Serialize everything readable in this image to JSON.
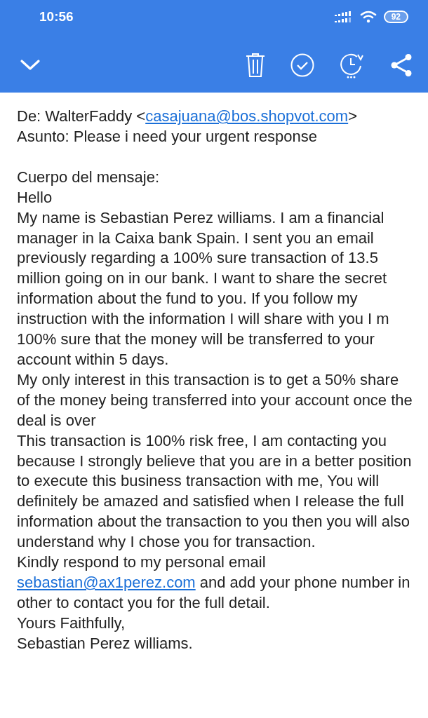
{
  "status_bar": {
    "time": "10:56",
    "battery": "92"
  },
  "email": {
    "from": {
      "prefix": "De: WalterFaddy <",
      "email": "casajuana@bos.shopvot.com",
      "suffix": ">"
    },
    "subject": "Asunto: Please i need your urgent response",
    "body_label": "Cuerpo del mensaje:",
    "paragraphs": [
      {
        "text": "Hello"
      },
      {
        "text": "My name is Sebastian Perez williams. I am a financial manager in la Caixa bank Spain. I sent you an email previously regarding a 100% sure transaction of 13.5 million going on in our bank. I want to share the secret information about the fund to you. If you follow my instruction with the information I will share with you I m 100% sure that the money will be transferred to your account within 5 days."
      },
      {
        "text": "My only interest in this transaction is to get a 50% share of the money being transferred into your account once the deal is over"
      },
      {
        "text": "This transaction is 100% risk free, I am contacting you because I strongly believe that you are in a better position to execute this business transaction with me, You will definitely be amazed and satisfied when I release the full information about the transaction to you then you will also understand why I chose you for transaction."
      },
      {
        "text": "Kindly respond to my personal email",
        "link": "sebastian@ax1perez.com",
        "after": "and add your phone number in other to contact you for the full detail."
      },
      {
        "text": "Yours Faithfully,"
      },
      {
        "text": "Sebastian Perez williams."
      }
    ]
  }
}
